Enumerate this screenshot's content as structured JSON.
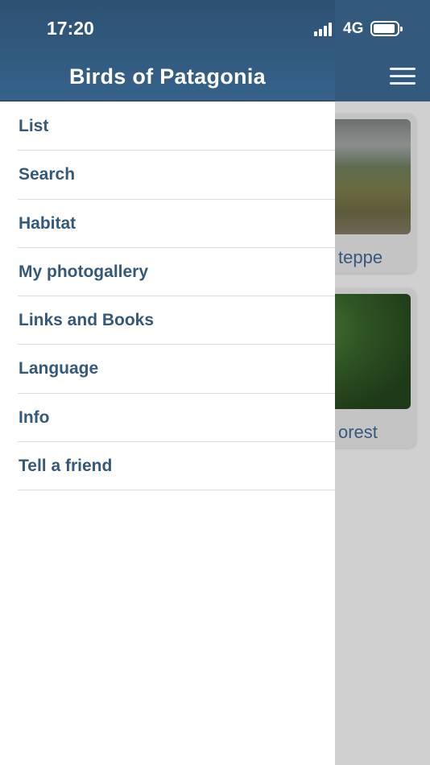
{
  "status_bar": {
    "time": "17:20",
    "network": "4G",
    "signal_icon": "signal-bars-icon",
    "battery_icon": "battery-icon"
  },
  "drawer": {
    "title": "Birds of Patagonia",
    "items": [
      {
        "label": "List"
      },
      {
        "label": "Search"
      },
      {
        "label": "Habitat"
      },
      {
        "label": "My photogallery"
      },
      {
        "label": "Links and Books"
      },
      {
        "label": "Language"
      },
      {
        "label": "Info"
      },
      {
        "label": "Tell a friend"
      }
    ]
  },
  "main": {
    "menu_icon": "hamburger-menu-icon",
    "cards": [
      {
        "label": "teppe",
        "photo": "steppe-landscape"
      },
      {
        "label": "orest",
        "photo": "forest-landscape"
      }
    ]
  },
  "colors": {
    "header": "#33597c",
    "accent_text": "#33597c",
    "drawer_bg": "#ffffff",
    "overlay_bg": "#d0d0d0"
  }
}
